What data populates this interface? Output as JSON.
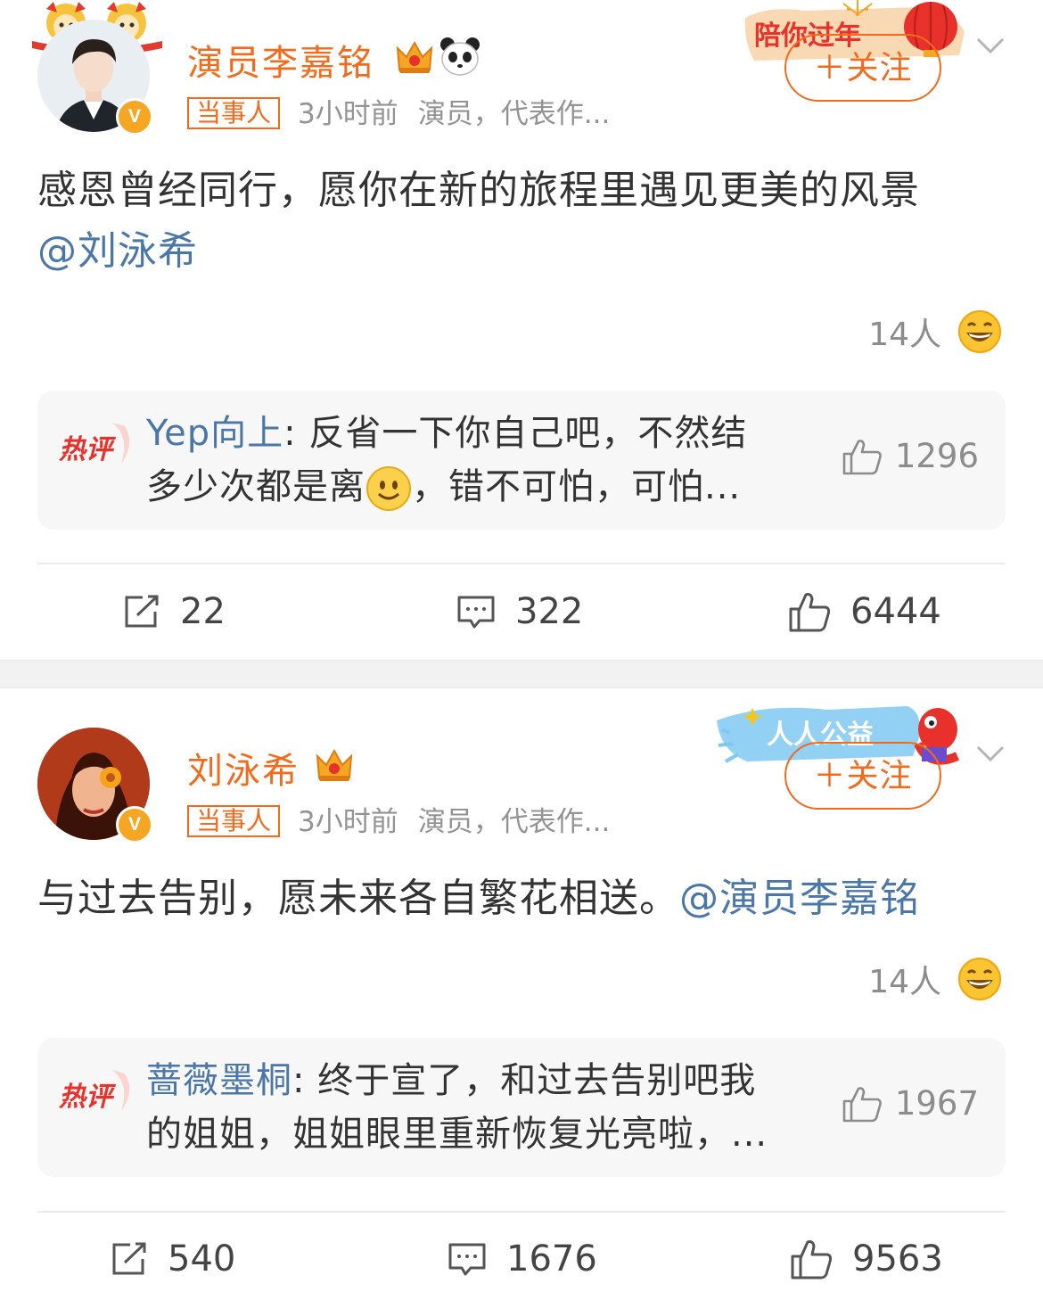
{
  "colors": {
    "accent": "#f26b1d",
    "link": "#4b77a8",
    "muted": "#939393",
    "hot_red": "#e8312a",
    "badge": "#f5a623"
  },
  "posts": [
    {
      "author": "演员李嘉铭",
      "tag": "当事人",
      "time": "3小时前",
      "bio": "演员，代表作...",
      "follow_label": "＋关注",
      "banner_text": "陪你过年",
      "text": "感恩曾经同行，愿你在新的旅程里遇见更美的风景",
      "mention": "@刘泳希",
      "reaction_count": "14人",
      "hot_comment": {
        "badge": "热评",
        "user": "Yep向上",
        "text_line1": "反省一下你自己吧，不然结",
        "text_line2_before": "多少次都是离",
        "text_line2_after": "，错不可怕，可怕...",
        "likes": "1296"
      },
      "actions": {
        "repost": "22",
        "comment": "322",
        "like": "6444"
      }
    },
    {
      "author": "刘泳希",
      "tag": "当事人",
      "time": "3小时前",
      "bio": "演员，代表作...",
      "follow_label": "＋关注",
      "banner_text": "人人公益",
      "text": "与过去告别，愿未来各自繁花相送。",
      "mention": "@演员李嘉铭",
      "reaction_count": "14人",
      "hot_comment": {
        "badge": "热评",
        "user": "蔷薇墨桐",
        "text_line1": "终于宣了，和过去告别吧我",
        "text_line2": "的姐姐，姐姐眼里重新恢复光亮啦，...",
        "likes": "1967"
      },
      "actions": {
        "repost": "540",
        "comment": "1676",
        "like": "9563"
      }
    }
  ]
}
